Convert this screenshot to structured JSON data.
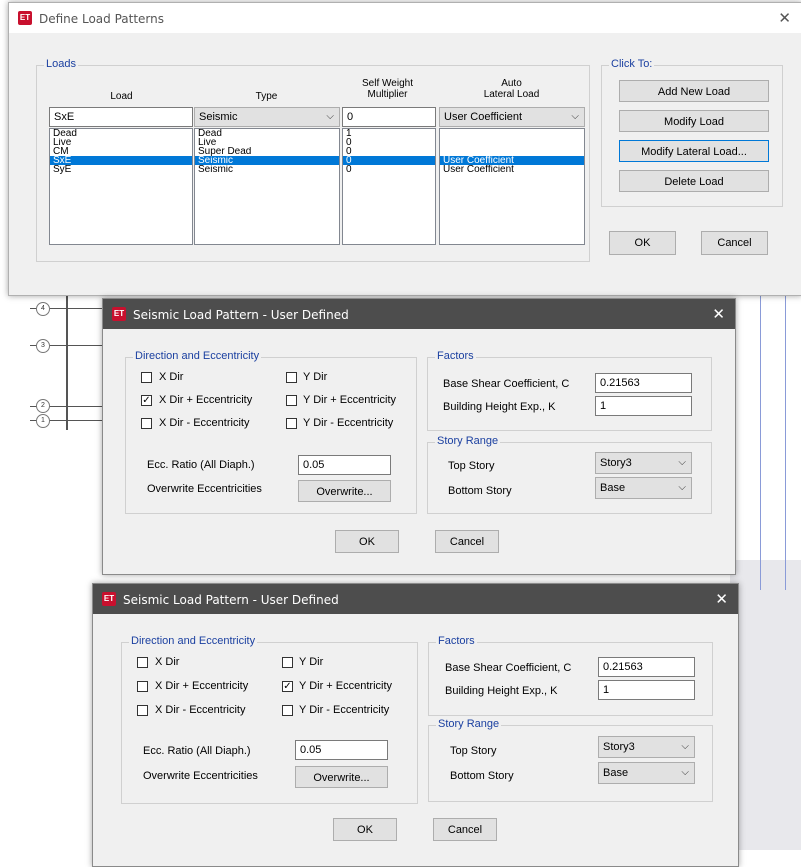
{
  "define_dialog": {
    "title": "Define Load Patterns",
    "loads_group": "Loads",
    "click_to_group": "Click To:",
    "col_headers": {
      "load": "Load",
      "type": "Type",
      "multiplier_1": "Self Weight",
      "multiplier_2": "Multiplier",
      "auto_1": "Auto",
      "auto_2": "Lateral Load"
    },
    "edit_row": {
      "load": "SxE",
      "type": "Seismic",
      "multiplier": "0",
      "auto": "User Coefficient"
    },
    "rows": [
      {
        "load": "Dead",
        "type": "Dead",
        "multiplier": "1",
        "auto": ""
      },
      {
        "load": "Live",
        "type": "Live",
        "multiplier": "0",
        "auto": ""
      },
      {
        "load": "CM",
        "type": "Super Dead",
        "multiplier": "0",
        "auto": ""
      },
      {
        "load": "SxE",
        "type": "Seismic",
        "multiplier": "0",
        "auto": "User Coefficient",
        "selected": true
      },
      {
        "load": "SyE",
        "type": "Seismic",
        "multiplier": "0",
        "auto": "User Coefficient"
      }
    ],
    "buttons": {
      "add": "Add New Load",
      "modify": "Modify Load",
      "modify_lateral": "Modify Lateral Load...",
      "delete": "Delete Load",
      "ok": "OK",
      "cancel": "Cancel"
    }
  },
  "seismic_dialogs": [
    {
      "title": "Seismic Load Pattern - User Defined",
      "direction_group": "Direction and Eccentricity",
      "x_dir": {
        "label": "X Dir",
        "checked": false
      },
      "y_dir": {
        "label": "Y Dir",
        "checked": false
      },
      "x_dir_plus": {
        "label": "X Dir + Eccentricity",
        "checked": true
      },
      "y_dir_plus": {
        "label": "Y Dir + Eccentricity",
        "checked": false
      },
      "x_dir_minus": {
        "label": "X Dir - Eccentricity",
        "checked": false
      },
      "y_dir_minus": {
        "label": "Y Dir - Eccentricity",
        "checked": false
      },
      "ecc_label": "Ecc. Ratio (All Diaph.)",
      "ecc_value": "0.05",
      "overwrite_label": "Overwrite Eccentricities",
      "overwrite_button": "Overwrite...",
      "factors_group": "Factors",
      "c_label": "Base Shear Coefficient, C",
      "c_value": "0.21563",
      "k_label": "Building Height Exp., K",
      "k_value": "1",
      "story_group": "Story Range",
      "top_label": "Top Story",
      "top_value": "Story3",
      "bottom_label": "Bottom Story",
      "bottom_value": "Base",
      "ok": "OK",
      "cancel": "Cancel",
      "check_mark": "✓",
      "close": "✕"
    },
    {
      "title": "Seismic Load Pattern - User Defined",
      "direction_group": "Direction and Eccentricity",
      "x_dir": {
        "label": "X Dir",
        "checked": false
      },
      "y_dir": {
        "label": "Y Dir",
        "checked": false
      },
      "x_dir_plus": {
        "label": "X Dir + Eccentricity",
        "checked": false
      },
      "y_dir_plus": {
        "label": "Y Dir + Eccentricity",
        "checked": true
      },
      "x_dir_minus": {
        "label": "X Dir - Eccentricity",
        "checked": false
      },
      "y_dir_minus": {
        "label": "Y Dir - Eccentricity",
        "checked": false
      },
      "ecc_label": "Ecc. Ratio (All Diaph.)",
      "ecc_value": "0.05",
      "overwrite_label": "Overwrite Eccentricities",
      "overwrite_button": "Overwrite...",
      "factors_group": "Factors",
      "c_label": "Base Shear Coefficient, C",
      "c_value": "0.21563",
      "k_label": "Building Height Exp., K",
      "k_value": "1",
      "story_group": "Story Range",
      "top_label": "Top Story",
      "top_value": "Story3",
      "bottom_label": "Bottom Story",
      "bottom_value": "Base",
      "ok": "OK",
      "cancel": "Cancel",
      "check_mark": "✓",
      "close": "✕"
    }
  ],
  "icons": {
    "app": "ET",
    "close": "✕",
    "dropdown": "⌵"
  },
  "colors": {
    "selection": "#0078d7",
    "group_label": "#1a3fa0",
    "dark_title": "#4d4d4d",
    "app_icon": "#c8102e"
  }
}
